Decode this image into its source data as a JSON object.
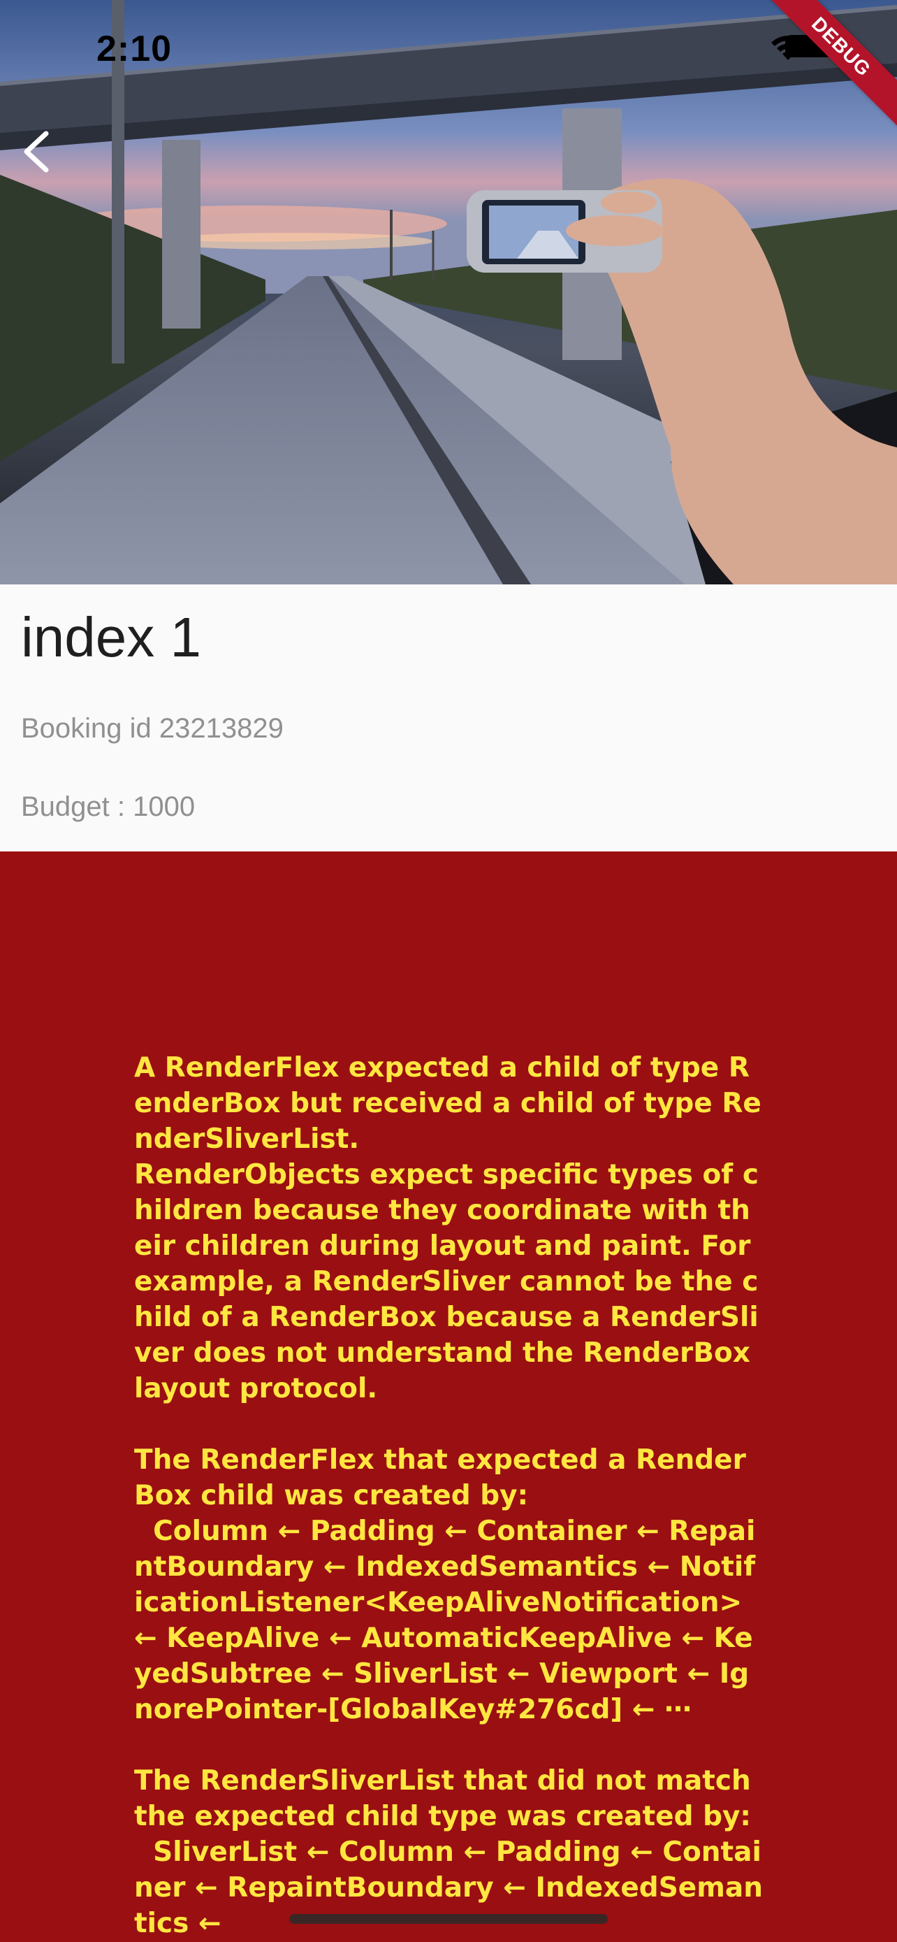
{
  "status_bar": {
    "time": "2:10"
  },
  "debug_banner": "DEBUG",
  "detail": {
    "title": "index 1",
    "booking_id": "Booking id 23213829",
    "budget": "Budget : 1000"
  },
  "error": {
    "message": "A RenderFlex expected a child of type RenderBox but received a child of type RenderSliverList.\nRenderObjects expect specific types of children because they coordinate with their children during layout and paint. For example, a RenderSliver cannot be the child of a RenderBox because a RenderSliver does not understand the RenderBox layout protocol.\n\nThe RenderFlex that expected a RenderBox child was created by:\n  Column ← Padding ← Container ← RepaintBoundary ← IndexedSemantics ← NotificationListener<KeepAliveNotification> ← KeepAlive ← AutomaticKeepAlive ← KeyedSubtree ← SliverList ← Viewport ← IgnorePointer-[GlobalKey#276cd] ← ⋯\n\nThe RenderSliverList that did not match the expected child type was created by:\n  SliverList ← Column ← Padding ← Container ← RepaintBoundary ← IndexedSemantics ←"
  },
  "icons": {
    "back": "chevron-left-icon",
    "wifi": "wifi-icon",
    "battery": "battery-icon"
  },
  "colors": {
    "error_background": "#9a0f12",
    "error_text": "#ffe640",
    "debug_banner": "#b3142a"
  }
}
